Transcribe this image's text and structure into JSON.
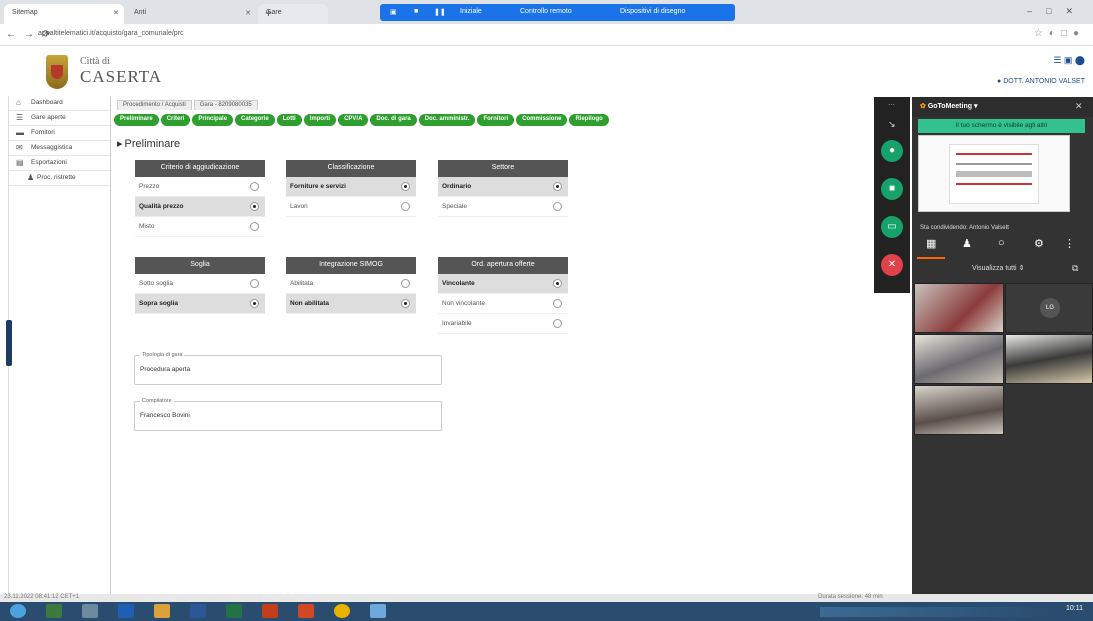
{
  "browser": {
    "tabs": [
      {
        "label": "Sitemap",
        "active": true
      },
      {
        "label": "Anti"
      },
      {
        "label": "Gare"
      }
    ],
    "url": "appaltitelematici.it/acquisto/gara_comunale/prc"
  },
  "screen_share_bar": {
    "buttons": [
      "Iniziale",
      "Controllo remoto",
      "Dispositivi di disegno"
    ]
  },
  "header": {
    "city_small": "Città di",
    "city_big": "CASERTA",
    "username": "DOTT. ANTONIO VALSET"
  },
  "leftmenu": {
    "items": [
      {
        "label": "Dashboard",
        "icon": "home-icon"
      },
      {
        "label": "Gare aperte",
        "icon": "list-icon"
      },
      {
        "label": "Fornitori",
        "icon": "truck-icon"
      },
      {
        "label": "Messaggistica",
        "icon": "mail-icon"
      },
      {
        "label": "Esportazioni",
        "icon": "file-icon"
      },
      {
        "label": "Proc. ristrette",
        "icon": "user-icon",
        "sub": true
      }
    ]
  },
  "breadcrumbs": [
    "Procedimento / Acquisti",
    "Gara - 8209080035"
  ],
  "steps": [
    "Preliminare",
    "Criteri",
    "Principale",
    "Categorie",
    "Lotti",
    "Importi",
    "CPV/A",
    "Doc. di gara",
    "Doc. amministr.",
    "Fornitori",
    "Commissione",
    "Riepilogo"
  ],
  "section_title": "Preliminare",
  "boxes": [
    {
      "title": "Criterio di aggiudicazione",
      "options": [
        {
          "label": "Prezzo",
          "selected": false
        },
        {
          "label": "Qualità prezzo",
          "selected": true
        },
        {
          "label": "Misto",
          "selected": false
        }
      ]
    },
    {
      "title": "Classificazione",
      "options": [
        {
          "label": "Forniture e servizi",
          "selected": true
        },
        {
          "label": "Lavori",
          "selected": false
        }
      ]
    },
    {
      "title": "Settore",
      "options": [
        {
          "label": "Ordinario",
          "selected": true
        },
        {
          "label": "Speciale",
          "selected": false
        }
      ]
    },
    {
      "title": "Soglia",
      "options": [
        {
          "label": "Sotto soglia",
          "selected": false
        },
        {
          "label": "Sopra soglia",
          "selected": true
        }
      ]
    },
    {
      "title": "Integrazione SIMOG",
      "options": [
        {
          "label": "Abilitata",
          "selected": false
        },
        {
          "label": "Non abilitata",
          "selected": true
        }
      ]
    },
    {
      "title": "Ord. apertura offerte",
      "options": [
        {
          "label": "Vincolante",
          "selected": true
        },
        {
          "label": "Non vincolante",
          "selected": false
        },
        {
          "label": "Invariabile",
          "selected": false
        }
      ]
    }
  ],
  "fields": [
    {
      "legend": "Tipologia di gara",
      "value": "Procedura aperta"
    },
    {
      "legend": "Compilatore",
      "value": "Francesco Bovini"
    }
  ],
  "meeting": {
    "title": "GoToMeeting",
    "banner": "Il tuo schermo è visibile agli altri",
    "share_line": "Sta condividendo: Antonio Valsett",
    "view_all": "Visualizza tutti",
    "participant_initials": "LG"
  },
  "statusbar": {
    "left": "23.11.2022 08:41:12 CET+1",
    "right": "Durata sessione: 48 min"
  },
  "taskbar": {
    "clock": "10:11"
  }
}
